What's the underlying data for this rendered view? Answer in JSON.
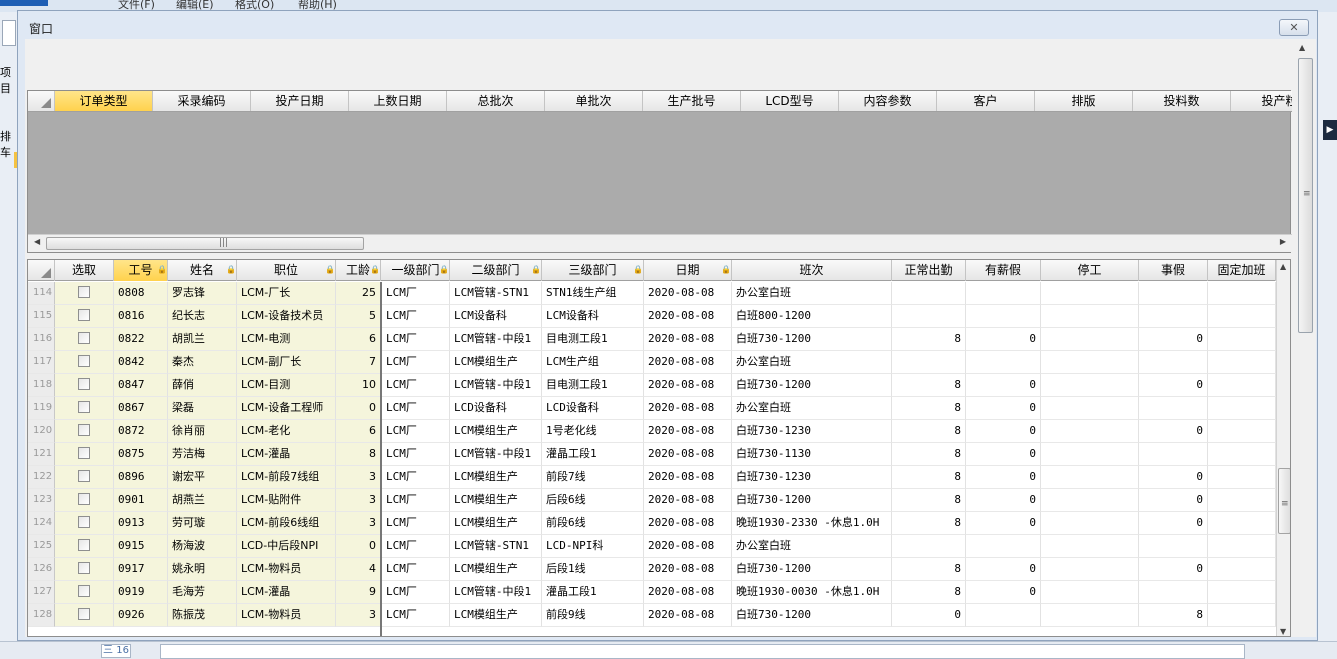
{
  "background": {
    "file_menu": "文件",
    "menus": [
      "文件(F)",
      "编辑(E)",
      "格式(O)",
      "帮助(H)"
    ],
    "left_labels": [
      "项目",
      "排车"
    ],
    "status_count": "三 16"
  },
  "window": {
    "title": "窗口",
    "close_icon": "close-icon"
  },
  "top_grid": {
    "columns": [
      "订单类型",
      "采录编码",
      "投产日期",
      "上数日期",
      "总批次",
      "单批次",
      "生产批号",
      "LCD型号",
      "内容参数",
      "客户",
      "排版",
      "投料数",
      "投产粒"
    ],
    "active_column": 0
  },
  "bottom_grid": {
    "columns": [
      "选取",
      "工号",
      "姓名",
      "职位",
      "工龄",
      "一级部门",
      "二级部门",
      "三级部门",
      "日期",
      "班次",
      "正常出勤",
      "有薪假",
      "停工",
      "事假",
      "固定加班"
    ],
    "active_column": 1,
    "rows": [
      {
        "rn": "114",
        "id": "0808",
        "name": "罗志锋",
        "pos": "LCM-厂长",
        "age": "25",
        "d1": "LCM厂",
        "d2": "LCM管辖-STN1",
        "d3": "STN1线生产组",
        "date": "2020-08-08",
        "shift": "办公室白班",
        "work": "",
        "paid": "",
        "stop": "",
        "leave": "",
        "ot": ""
      },
      {
        "rn": "115",
        "id": "0816",
        "name": "纪长志",
        "pos": "LCM-设备技术员",
        "age": "5",
        "d1": "LCM厂",
        "d2": "LCM设备科",
        "d3": "LCM设备科",
        "date": "2020-08-08",
        "shift": "白班800-1200",
        "work": "",
        "paid": "",
        "stop": "",
        "leave": "",
        "ot": ""
      },
      {
        "rn": "116",
        "id": "0822",
        "name": "胡凯兰",
        "pos": "LCM-电测",
        "age": "6",
        "d1": "LCM厂",
        "d2": "LCM管辖-中段1",
        "d3": "目电测工段1",
        "date": "2020-08-08",
        "shift": "白班730-1200",
        "work": "8",
        "paid": "0",
        "stop": "",
        "leave": "0",
        "ot": ""
      },
      {
        "rn": "117",
        "id": "0842",
        "name": "秦杰",
        "pos": "LCM-副厂长",
        "age": "7",
        "d1": "LCM厂",
        "d2": "LCM模组生产",
        "d3": "LCM生产组",
        "date": "2020-08-08",
        "shift": "办公室白班",
        "work": "",
        "paid": "",
        "stop": "",
        "leave": "",
        "ot": ""
      },
      {
        "rn": "118",
        "id": "0847",
        "name": "薛俏",
        "pos": "LCM-目测",
        "age": "10",
        "d1": "LCM厂",
        "d2": "LCM管辖-中段1",
        "d3": "目电测工段1",
        "date": "2020-08-08",
        "shift": "白班730-1200",
        "work": "8",
        "paid": "0",
        "stop": "",
        "leave": "0",
        "ot": ""
      },
      {
        "rn": "119",
        "id": "0867",
        "name": "梁磊",
        "pos": "LCM-设备工程师",
        "age": "0",
        "d1": "LCM厂",
        "d2": "LCD设备科",
        "d3": "LCD设备科",
        "date": "2020-08-08",
        "shift": "办公室白班",
        "work": "8",
        "paid": "0",
        "stop": "",
        "leave": "",
        "ot": ""
      },
      {
        "rn": "120",
        "id": "0872",
        "name": "徐肖丽",
        "pos": "LCM-老化",
        "age": "6",
        "d1": "LCM厂",
        "d2": "LCM模组生产",
        "d3": "1号老化线",
        "date": "2020-08-08",
        "shift": "白班730-1230",
        "work": "8",
        "paid": "0",
        "stop": "",
        "leave": "0",
        "ot": ""
      },
      {
        "rn": "121",
        "id": "0875",
        "name": "芳洁梅",
        "pos": "LCM-灌晶",
        "age": "8",
        "d1": "LCM厂",
        "d2": "LCM管辖-中段1",
        "d3": "灌晶工段1",
        "date": "2020-08-08",
        "shift": "白班730-1130",
        "work": "8",
        "paid": "0",
        "stop": "",
        "leave": "",
        "ot": ""
      },
      {
        "rn": "122",
        "id": "0896",
        "name": "谢宏平",
        "pos": "LCM-前段7线组",
        "age": "3",
        "d1": "LCM厂",
        "d2": "LCM模组生产",
        "d3": "前段7线",
        "date": "2020-08-08",
        "shift": "白班730-1230",
        "work": "8",
        "paid": "0",
        "stop": "",
        "leave": "0",
        "ot": ""
      },
      {
        "rn": "123",
        "id": "0901",
        "name": "胡燕兰",
        "pos": "LCM-贴附件",
        "age": "3",
        "d1": "LCM厂",
        "d2": "LCM模组生产",
        "d3": "后段6线",
        "date": "2020-08-08",
        "shift": "白班730-1200",
        "work": "8",
        "paid": "0",
        "stop": "",
        "leave": "0",
        "ot": ""
      },
      {
        "rn": "124",
        "id": "0913",
        "name": "劳可璇",
        "pos": "LCM-前段6线组",
        "age": "3",
        "d1": "LCM厂",
        "d2": "LCM模组生产",
        "d3": "前段6线",
        "date": "2020-08-08",
        "shift": "晚班1930-2330 -休息1.0H",
        "work": "8",
        "paid": "0",
        "stop": "",
        "leave": "0",
        "ot": ""
      },
      {
        "rn": "125",
        "id": "0915",
        "name": "杨海波",
        "pos": "LCD-中后段NPI",
        "age": "0",
        "d1": "LCM厂",
        "d2": "LCM管辖-STN1",
        "d3": "LCD-NPI科",
        "date": "2020-08-08",
        "shift": "办公室白班",
        "work": "",
        "paid": "",
        "stop": "",
        "leave": "",
        "ot": ""
      },
      {
        "rn": "126",
        "id": "0917",
        "name": "姚永明",
        "pos": "LCM-物料员",
        "age": "4",
        "d1": "LCM厂",
        "d2": "LCM模组生产",
        "d3": "后段1线",
        "date": "2020-08-08",
        "shift": "白班730-1200",
        "work": "8",
        "paid": "0",
        "stop": "",
        "leave": "0",
        "ot": ""
      },
      {
        "rn": "127",
        "id": "0919",
        "name": "毛海芳",
        "pos": "LCM-灌晶",
        "age": "9",
        "d1": "LCM厂",
        "d2": "LCM管辖-中段1",
        "d3": "灌晶工段1",
        "date": "2020-08-08",
        "shift": "晚班1930-0030 -休息1.0H",
        "work": "8",
        "paid": "0",
        "stop": "",
        "leave": "",
        "ot": ""
      },
      {
        "rn": "128",
        "id": "0926",
        "name": "陈振茂",
        "pos": "LCM-物料员",
        "age": "3",
        "d1": "LCM厂",
        "d2": "LCM模组生产",
        "d3": "前段9线",
        "date": "2020-08-08",
        "shift": "白班730-1200",
        "work": "0",
        "paid": "",
        "stop": "",
        "leave": "8",
        "ot": ""
      }
    ]
  },
  "colors": {
    "active_header": "#ffd24d",
    "frozen_bg": "#f5f5dc",
    "empty_grid": "#ababab"
  }
}
